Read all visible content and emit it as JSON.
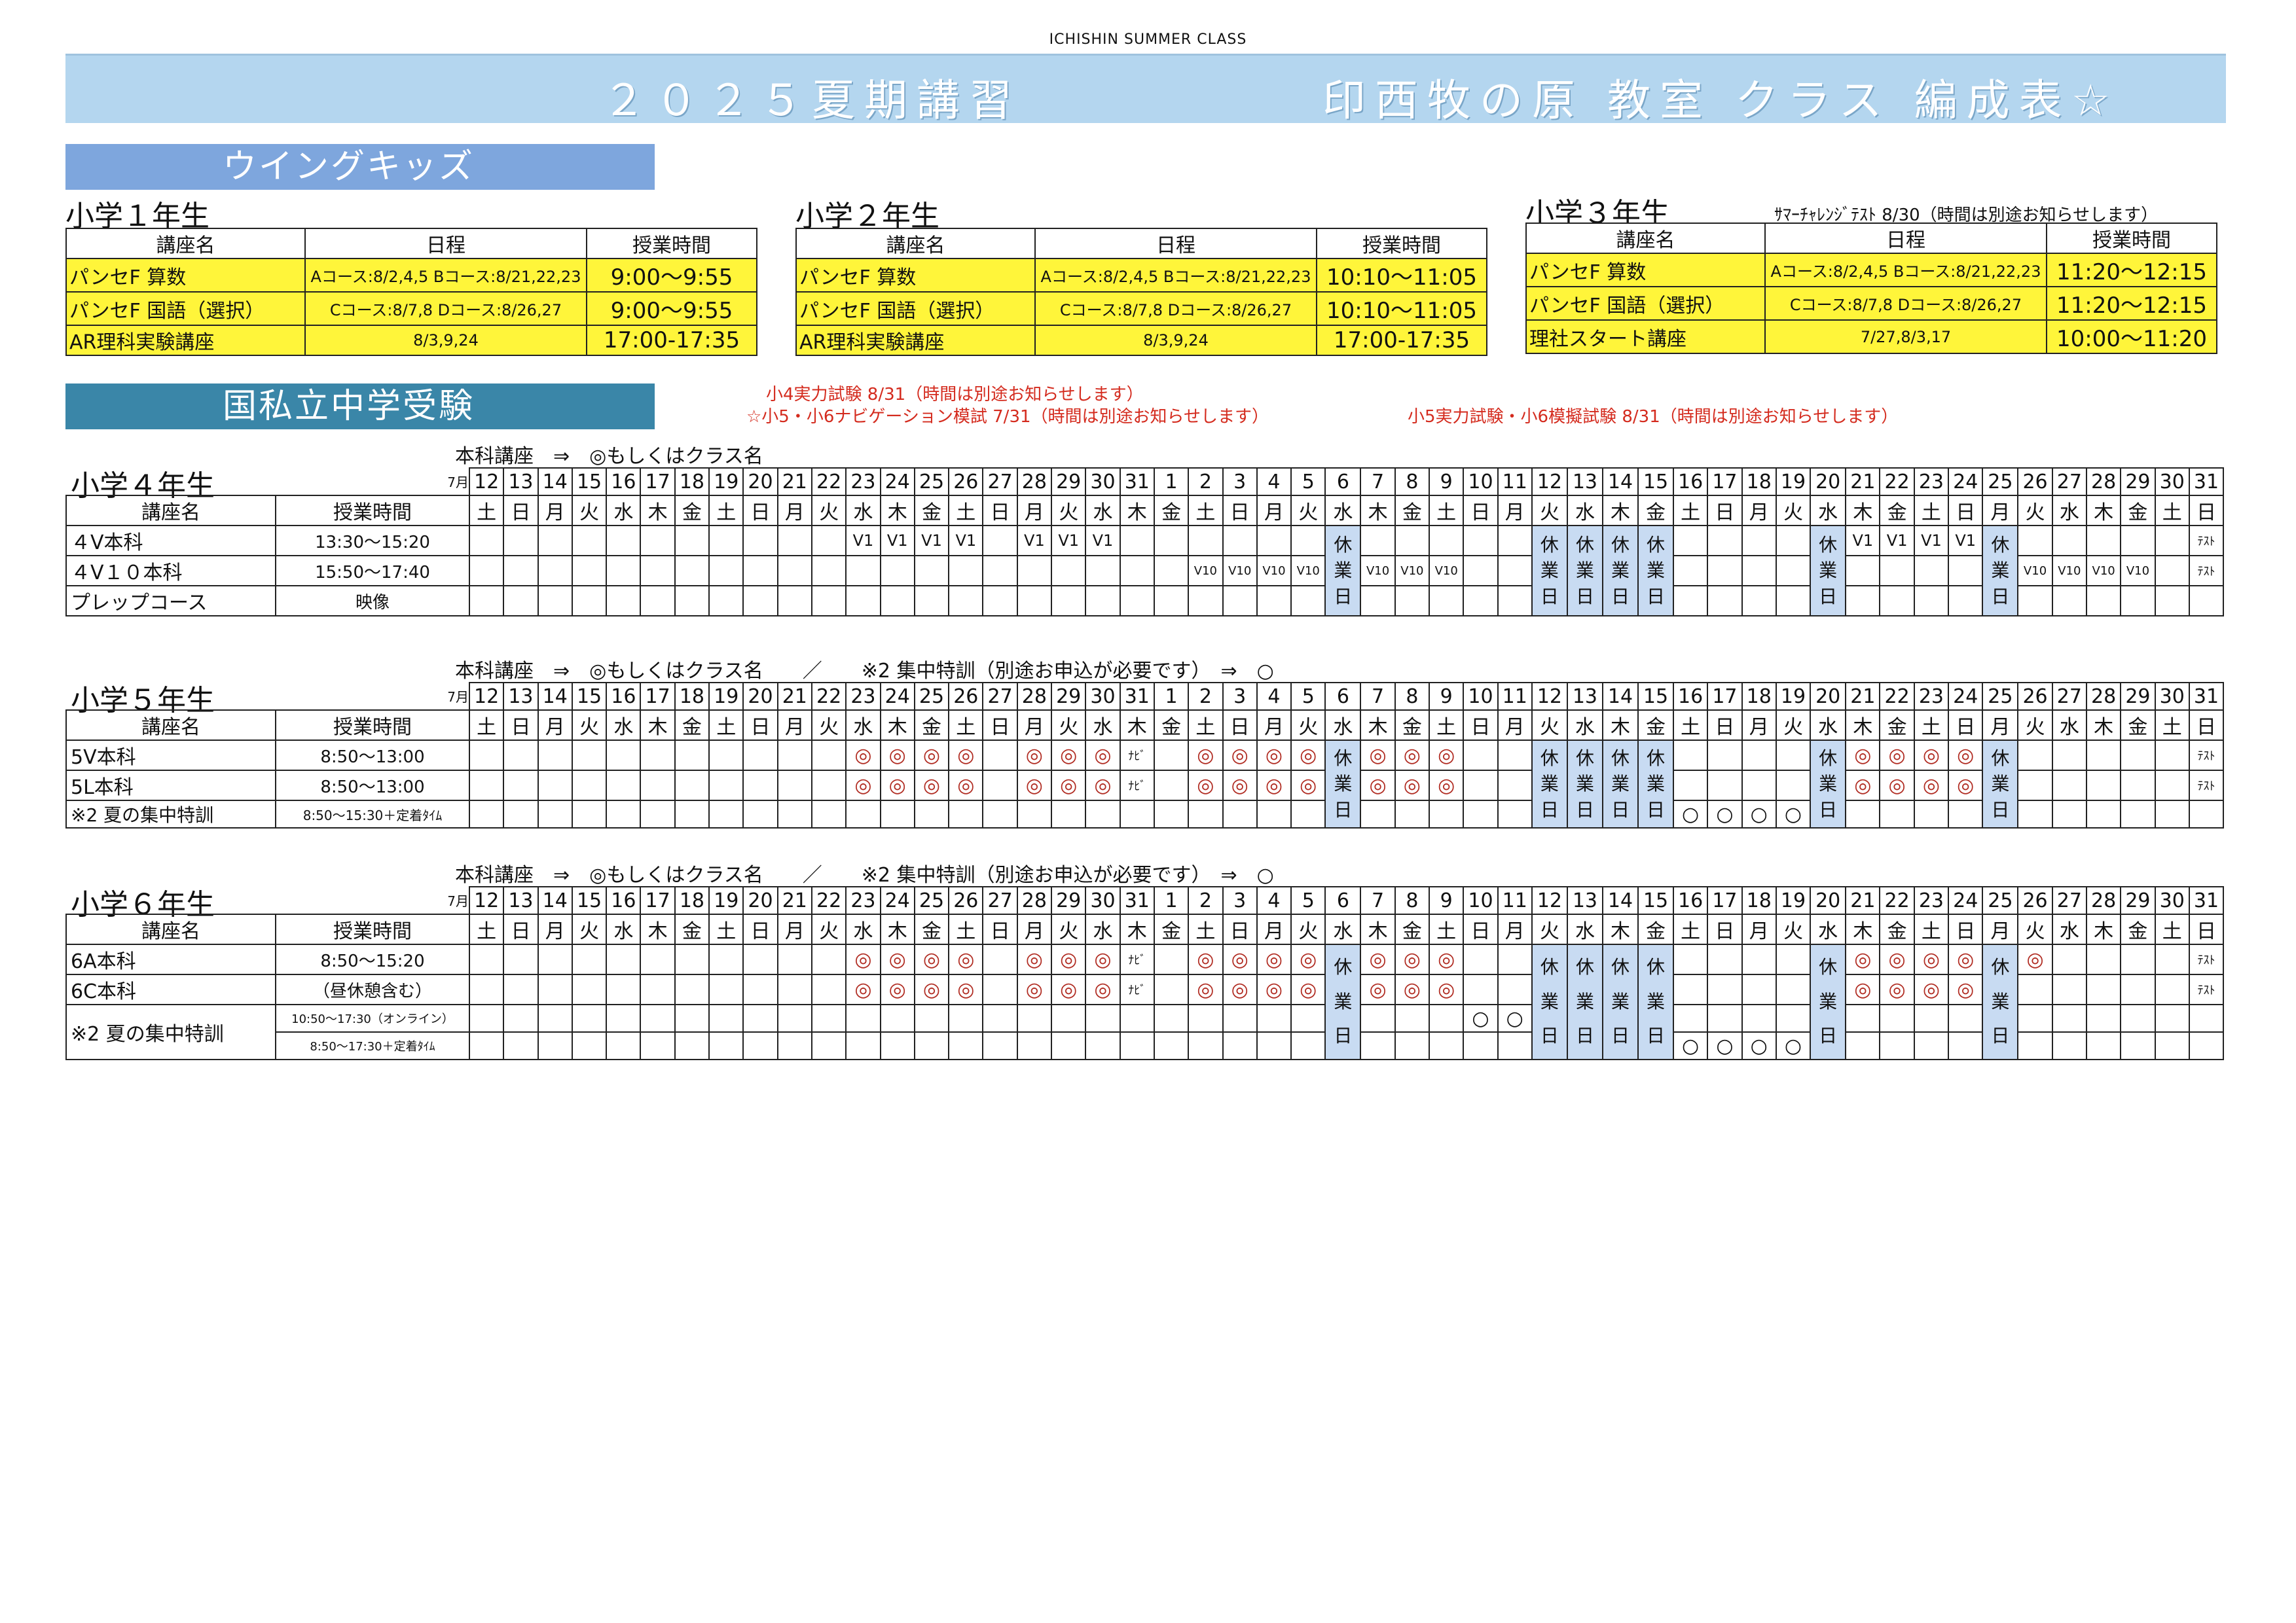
{
  "header": {
    "caption": "ICHISHIN SUMMER CLASS",
    "title_left": "２０２５夏期講習",
    "title_right": "印西牧の原 教室 クラス 編成表☆"
  },
  "sections": {
    "wing": "ウイングキッズ",
    "koku": "国私立中学受験"
  },
  "wing": {
    "headers": [
      "講座名",
      "日程",
      "授業時間"
    ],
    "grades": [
      {
        "label": "小学１年生",
        "note": "",
        "rows": [
          [
            "パンセF 算数",
            "Aコース:8/2,4,5  Bコース:8/21,22,23",
            "9:00～9:55"
          ],
          [
            "パンセF 国語（選択）",
            "Cコース:8/7,8   Dコース:8/26,27",
            "9:00～9:55"
          ],
          [
            "AR理科実験講座",
            "8/3,9,24",
            "17:00-17:35"
          ]
        ]
      },
      {
        "label": "小学２年生",
        "note": "",
        "rows": [
          [
            "パンセF 算数",
            "Aコース:8/2,4,5  Bコース:8/21,22,23",
            "10:10～11:05"
          ],
          [
            "パンセF 国語（選択）",
            "Cコース:8/7,8   Dコース:8/26,27",
            "10:10～11:05"
          ],
          [
            "AR理科実験講座",
            "8/3,9,24",
            "17:00-17:35"
          ]
        ]
      },
      {
        "label": "小学３年生",
        "note": "ｻﾏｰﾁｬﾚﾝｼﾞﾃｽﾄ  8/30（時間は別途お知らせします）",
        "rows": [
          [
            "パンセF 算数",
            "Aコース:8/2,4,5  Bコース:8/21,22,23",
            "11:20～12:15"
          ],
          [
            "パンセF 国語（選択）",
            "Cコース:8/7,8   Dコース:8/26,27",
            "11:20～12:15"
          ],
          [
            "理社スタート講座",
            "7/27,8/3,17",
            "10:00～11:20"
          ]
        ]
      }
    ]
  },
  "notes": {
    "n1": "小4実力試験 8/31（時間は別途お知らせします）",
    "n2": "☆小5・小6ナビゲーション模試 7/31（時間は別途お知らせします）",
    "n3": "小5実力試験・小6模擬試験 8/31（時間は別途お知らせします）"
  },
  "legend": {
    "g4": "本科講座　⇒　◎もしくはクラス名",
    "g56": "本科講座　⇒　◎もしくはクラス名　　／　　※2 集中特訓（別途お申込が必要です）　⇒　○"
  },
  "calendar": {
    "month_label": "7月",
    "days": [
      "12",
      "13",
      "14",
      "15",
      "16",
      "17",
      "18",
      "19",
      "20",
      "21",
      "22",
      "23",
      "24",
      "25",
      "26",
      "27",
      "28",
      "29",
      "30",
      "31",
      "1",
      "2",
      "3",
      "4",
      "5",
      "6",
      "7",
      "8",
      "9",
      "10",
      "11",
      "12",
      "13",
      "14",
      "15",
      "16",
      "17",
      "18",
      "19",
      "20",
      "21",
      "22",
      "23",
      "24",
      "25",
      "26",
      "27",
      "28",
      "29",
      "30",
      "31"
    ],
    "weekdays": [
      "土",
      "日",
      "月",
      "火",
      "水",
      "木",
      "金",
      "土",
      "日",
      "月",
      "火",
      "水",
      "木",
      "金",
      "土",
      "日",
      "月",
      "火",
      "水",
      "木",
      "金",
      "土",
      "日",
      "月",
      "火",
      "水",
      "木",
      "金",
      "土",
      "日",
      "月",
      "火",
      "水",
      "木",
      "金",
      "土",
      "日",
      "月",
      "火",
      "水",
      "木",
      "金",
      "土",
      "日",
      "月",
      "火",
      "水",
      "木",
      "金",
      "土",
      "日"
    ],
    "holiday_text": "休業日",
    "col_name": "講座名",
    "col_time": "授業時間",
    "g4": {
      "label": "小学４年生",
      "rows": [
        {
          "name": "４V本科",
          "time": "13:30～15:20",
          "cells": {
            "11": "V1",
            "12": "V1",
            "13": "V1",
            "14": "V1",
            "16": "V1",
            "17": "V1",
            "18": "V1",
            "40": "V1",
            "41": "V1",
            "42": "V1",
            "43": "V1",
            "50": "ﾃｽﾄ"
          }
        },
        {
          "name": "４V１０本科",
          "time": "15:50～17:40",
          "cells": {
            "21": "V10",
            "22": "V10",
            "23": "V10",
            "24": "V10",
            "26": "V10",
            "27": "V10",
            "28": "V10",
            "45": "V10",
            "46": "V10",
            "47": "V10",
            "48": "V10",
            "50": "ﾃｽﾄ"
          }
        },
        {
          "name": "プレップコース",
          "time": "映像",
          "cells": {}
        }
      ]
    },
    "g5": {
      "label": "小学５年生",
      "rows": [
        {
          "name": "5V本科",
          "time": "8:50～13:00",
          "cells": {
            "11": "◎",
            "12": "◎",
            "13": "◎",
            "14": "◎",
            "16": "◎",
            "17": "◎",
            "18": "◎",
            "19": "ﾅﾋﾞ",
            "21": "◎",
            "22": "◎",
            "23": "◎",
            "24": "◎",
            "26": "◎",
            "27": "◎",
            "28": "◎",
            "40": "◎",
            "41": "◎",
            "42": "◎",
            "43": "◎",
            "50": "ﾃｽﾄ"
          }
        },
        {
          "name": "5L本科",
          "time": "8:50～13:00",
          "cells": {
            "11": "◎",
            "12": "◎",
            "13": "◎",
            "14": "◎",
            "16": "◎",
            "17": "◎",
            "18": "◎",
            "19": "ﾅﾋﾞ",
            "21": "◎",
            "22": "◎",
            "23": "◎",
            "24": "◎",
            "26": "◎",
            "27": "◎",
            "28": "◎",
            "40": "◎",
            "41": "◎",
            "42": "◎",
            "43": "◎",
            "50": "ﾃｽﾄ"
          }
        },
        {
          "name": "※2 夏の集中特訓",
          "time": "8:50～15:30＋定着ﾀｲﾑ",
          "cells": {
            "35": "○",
            "36": "○",
            "37": "○",
            "38": "○"
          }
        }
      ]
    },
    "g6": {
      "label": "小学６年生",
      "rows": [
        {
          "name": "6A本科",
          "time": "8:50～15:20",
          "cells": {
            "11": "◎",
            "12": "◎",
            "13": "◎",
            "14": "◎",
            "16": "◎",
            "17": "◎",
            "18": "◎",
            "19": "ﾅﾋﾞ",
            "21": "◎",
            "22": "◎",
            "23": "◎",
            "24": "◎",
            "26": "◎",
            "27": "◎",
            "28": "◎",
            "40": "◎",
            "41": "◎",
            "42": "◎",
            "43": "◎",
            "45": "◎",
            "50": "ﾃｽﾄ"
          }
        },
        {
          "name": "6C本科",
          "time": "（昼休憩含む）",
          "cells": {
            "11": "◎",
            "12": "◎",
            "13": "◎",
            "14": "◎",
            "16": "◎",
            "17": "◎",
            "18": "◎",
            "19": "ﾅﾋﾞ",
            "21": "◎",
            "22": "◎",
            "23": "◎",
            "24": "◎",
            "26": "◎",
            "27": "◎",
            "28": "◎",
            "40": "◎",
            "41": "◎",
            "42": "◎",
            "43": "◎",
            "50": "ﾃｽﾄ"
          }
        },
        {
          "name": "※2 夏の集中特訓",
          "time": "10:50～17:30（オンライン）",
          "cells": {
            "29": "○",
            "30": "○"
          }
        },
        {
          "name": "",
          "time": "8:50～17:30＋定着ﾀｲﾑ",
          "cells": {
            "35": "○",
            "36": "○",
            "37": "○",
            "38": "○"
          }
        }
      ]
    }
  }
}
